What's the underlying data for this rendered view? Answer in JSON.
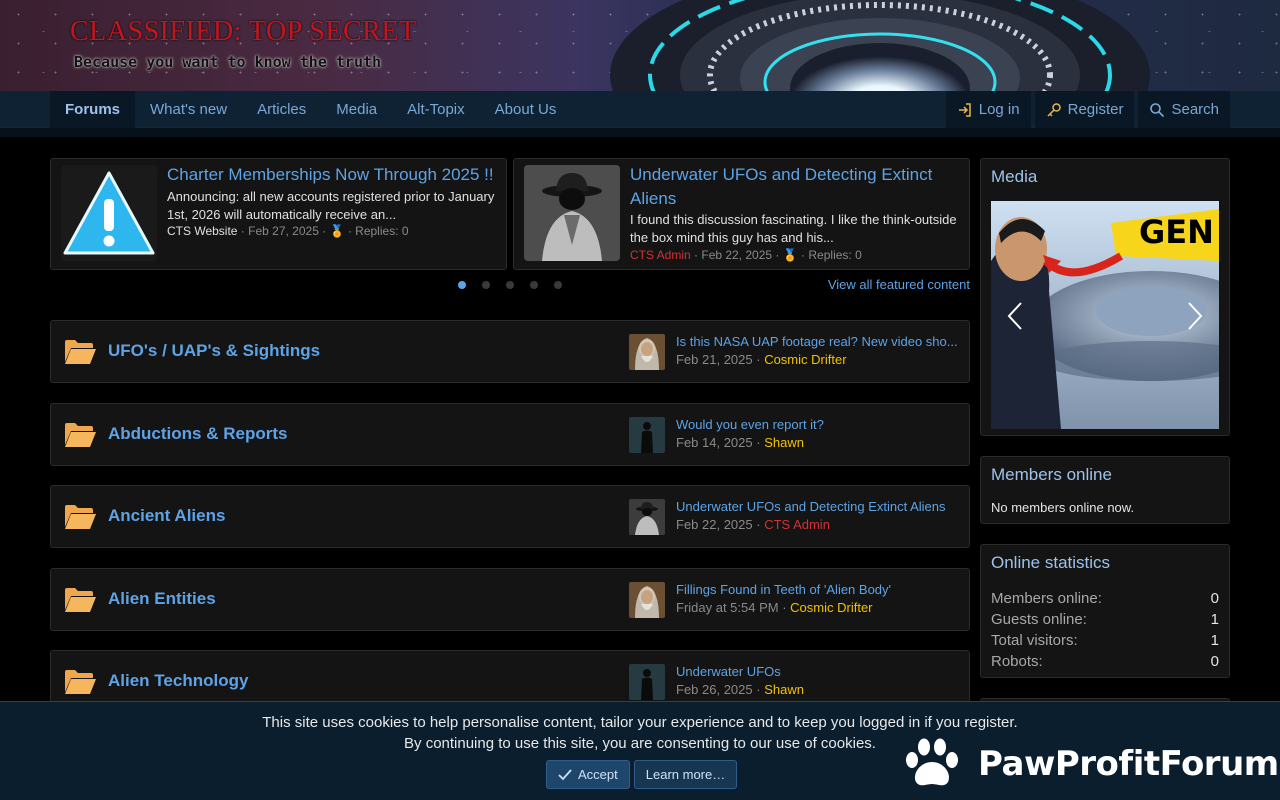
{
  "banner": {
    "title": "CLASSIFIED: TOP SECRET",
    "tagline": "Because you want to know the truth"
  },
  "nav": {
    "tabs": [
      {
        "label": "Forums",
        "active": true
      },
      {
        "label": "What's new"
      },
      {
        "label": "Articles"
      },
      {
        "label": "Media"
      },
      {
        "label": "Alt-Topix"
      },
      {
        "label": "About Us"
      }
    ],
    "login": "Log in",
    "register": "Register",
    "search": "Search"
  },
  "featured": [
    {
      "title": "Charter Memberships Now Through 2025 !!",
      "body": "Announcing: all new accounts registered prior to January 1st, 2026 will automatically receive an...",
      "author": "CTS Website",
      "date": "Feb 27, 2025",
      "replies": "Replies: 0",
      "icon": "warning-icon"
    },
    {
      "title": "Underwater UFOs and Detecting Extinct Aliens",
      "body": "I found this discussion fascinating. I like the think-outside the box mind this guy has and his...",
      "author": "CTS Admin",
      "date": "Feb 22, 2025",
      "replies": "Replies: 0",
      "icon": "hat-man-icon"
    }
  ],
  "carousel": {
    "count": 5,
    "active": 0
  },
  "view_all": "View all featured content",
  "forums": [
    {
      "name": "UFO's / UAP's & Sightings",
      "latest": "Is this NASA UAP footage real? New video sho...",
      "date": "Feb 21, 2025",
      "user": "Cosmic Drifter",
      "admin": false,
      "avatar": "old-man-avatar"
    },
    {
      "name": "Abductions & Reports",
      "latest": "Would you even report it?",
      "date": "Feb 14, 2025",
      "user": "Shawn",
      "admin": false,
      "avatar": "figure-avatar"
    },
    {
      "name": "Ancient Aliens",
      "latest": "Underwater UFOs and Detecting Extinct Aliens",
      "date": "Feb 22, 2025",
      "user": "CTS Admin",
      "admin": true,
      "avatar": "hat-man-avatar"
    },
    {
      "name": "Alien Entities",
      "latest": "Fillings Found in Teeth of 'Alien Body'",
      "date": "Friday at 5:54 PM",
      "user": "Cosmic Drifter",
      "admin": false,
      "avatar": "old-man-avatar"
    },
    {
      "name": "Alien Technology",
      "latest": "Underwater UFOs",
      "date": "Feb 26, 2025",
      "user": "Shawn",
      "admin": false,
      "avatar": "figure-avatar"
    }
  ],
  "sidebar": {
    "media": {
      "heading": "Media",
      "overlay_text": "GEN"
    },
    "members_online": {
      "heading": "Members online",
      "text": "No members online now."
    },
    "stats": {
      "heading": "Online statistics",
      "rows": [
        {
          "label": "Members online:",
          "value": "0"
        },
        {
          "label": "Guests online:",
          "value": "1"
        },
        {
          "label": "Total visitors:",
          "value": "1"
        },
        {
          "label": "Robots:",
          "value": "0"
        }
      ]
    }
  },
  "cookie": {
    "line1": "This site uses cookies to help personalise content, tailor your experience and to keep you logged in if you register.",
    "line2": "By continuing to use this site, you are consenting to our use of cookies.",
    "accept": "Accept",
    "learn_more": "Learn more…"
  },
  "watermark": "PawProfitForum",
  "colors": {
    "link": "#5ea3e6",
    "user": "#f2c200",
    "admin": "#d23232",
    "nav_bg": "#0e2233"
  }
}
